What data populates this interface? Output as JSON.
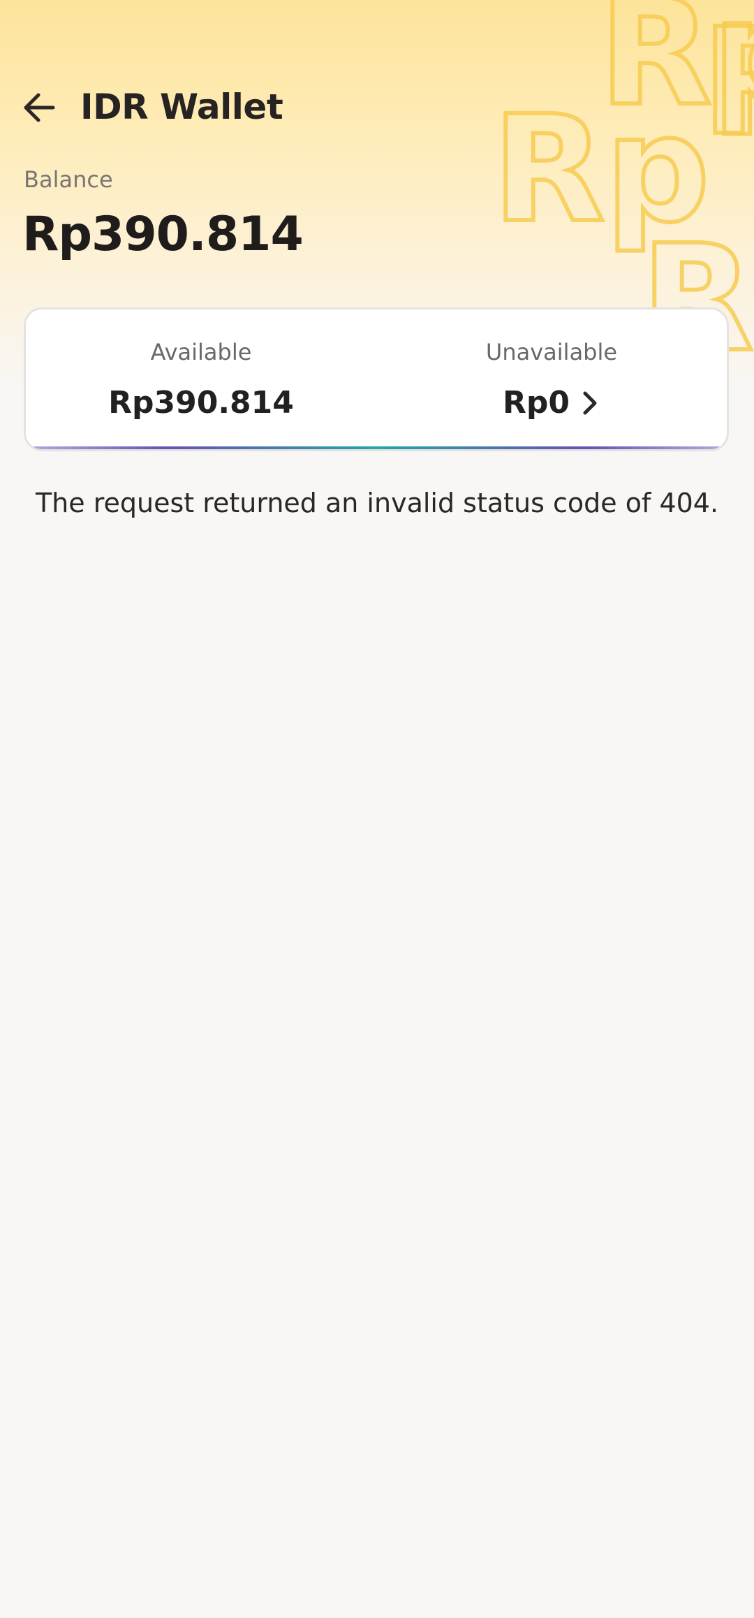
{
  "header": {
    "title": "IDR Wallet",
    "back_icon": "arrow-left-icon",
    "decoration_text": "Rp",
    "decoration_color": "#f8cc52"
  },
  "balance": {
    "label": "Balance",
    "value": "Rp390.814"
  },
  "summary": {
    "available_label": "Available",
    "available_value": "Rp390.814",
    "unavailable_label": "Unavailable",
    "unavailable_value": "Rp0",
    "unavailable_icon": "chevron-right-icon"
  },
  "message": {
    "error": "The request returned an invalid status code of 404."
  },
  "colors": {
    "header_top": "#fde49a",
    "background": "#f8f7f5",
    "accent_teal": "#1fa6a8",
    "accent_purple": "#6a4fb8"
  }
}
